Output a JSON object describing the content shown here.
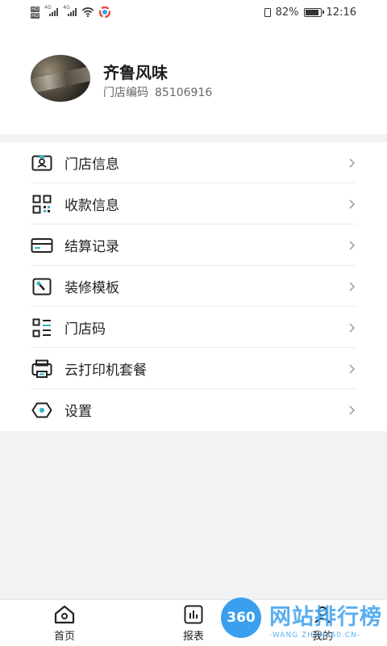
{
  "status_bar": {
    "net_tags": [
      "HD",
      "HD"
    ],
    "net_gen": [
      "4G",
      "4G"
    ],
    "battery_percent": "82%",
    "battery_level": 0.82,
    "time": "12:16"
  },
  "profile": {
    "store_name": "齐鲁风味",
    "code_label": "门店编码",
    "code_value": "85106916"
  },
  "menu": {
    "items": [
      {
        "label": "门店信息",
        "icon": "store-info-icon"
      },
      {
        "label": "收款信息",
        "icon": "qr-code-icon"
      },
      {
        "label": "结算记录",
        "icon": "card-icon"
      },
      {
        "label": "装修模板",
        "icon": "wrench-icon"
      },
      {
        "label": "门店码",
        "icon": "store-code-icon"
      },
      {
        "label": "云打印机套餐",
        "icon": "printer-icon"
      },
      {
        "label": "设置",
        "icon": "settings-icon"
      }
    ]
  },
  "tabbar": {
    "tabs": [
      {
        "label": "首页",
        "icon": "home-icon"
      },
      {
        "label": "报表",
        "icon": "report-icon"
      },
      {
        "label": "我的",
        "icon": "profile-icon"
      }
    ]
  },
  "watermark": {
    "badge": "360",
    "text": "网站排行榜",
    "sub": "-WANG ZHAN360.CN-"
  },
  "colors": {
    "background": "#f1f2f4",
    "surface": "#ffffff",
    "text": "#222222",
    "watermark": "#4aa8ef"
  }
}
